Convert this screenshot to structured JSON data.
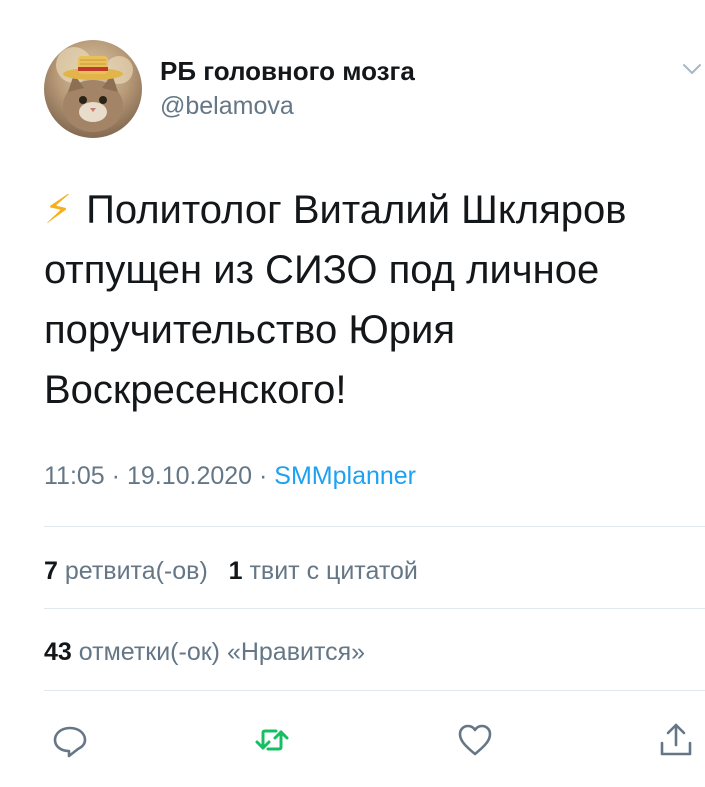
{
  "author": {
    "display_name": "РБ головного мозга",
    "handle": "@belamova"
  },
  "tweet": {
    "emoji": "⚡",
    "lines": [
      "Политолог Виталий Шкляров",
      "отпущен из СИЗО под личное",
      "поручительство Юрия",
      "Воскресенского!"
    ]
  },
  "meta": {
    "time": "11:05",
    "separator1": " · ",
    "date": "19.10.2020",
    "separator2": " · ",
    "source": "SMMplanner"
  },
  "stats": {
    "retweets_count": "7",
    "retweets_label": "ретвита(-ов)",
    "quotes_count": "1",
    "quotes_label": "твит с цитатой",
    "likes_count": "43",
    "likes_label": "отметки(-ок) «Нравится»"
  },
  "colors": {
    "text": "#14171a",
    "secondary": "#657786",
    "link": "#1da1f2",
    "retweet_green": "#17bf63",
    "divider": "#e1e8ed",
    "bolt": "#f5b021"
  },
  "icons": {
    "reply": "reply-icon",
    "retweet": "retweet-icon",
    "like": "like-icon",
    "share": "share-icon",
    "more": "chevron-down-icon"
  }
}
